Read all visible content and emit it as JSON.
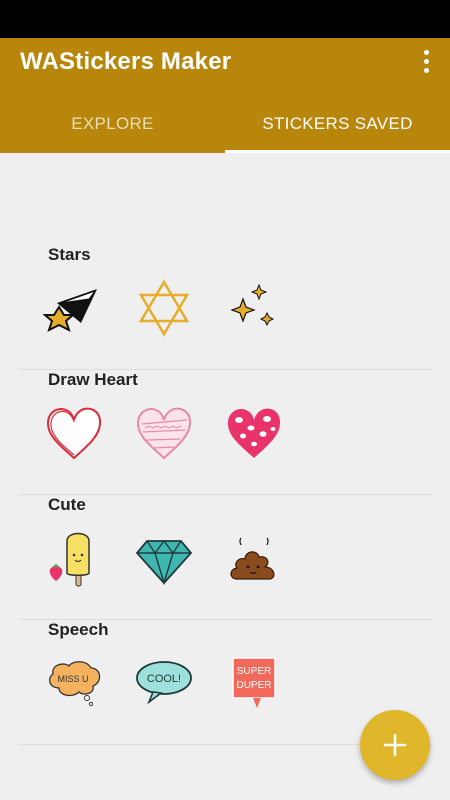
{
  "app": {
    "title": "WAStickers Maker"
  },
  "tabs": [
    {
      "label": "EXPLORE",
      "active": false
    },
    {
      "label": "STICKERS SAVED",
      "active": true
    }
  ],
  "packs": [
    {
      "title": "Stars",
      "stickers": [
        "shooting-star-sticker",
        "hexagram-star-sticker",
        "sparkles-sticker"
      ]
    },
    {
      "title": "Draw Heart",
      "stickers": [
        "red-outline-heart-sticker",
        "pink-pattern-heart-sticker",
        "pink-leopard-heart-sticker"
      ]
    },
    {
      "title": "Cute",
      "stickers": [
        "popsicle-strawberry-sticker",
        "diamond-sticker",
        "poop-sticker"
      ]
    },
    {
      "title": "Speech",
      "stickers": [
        "miss-u-bubble-sticker",
        "cool-bubble-sticker",
        "super-duper-bubble-sticker"
      ]
    }
  ],
  "stickers_text": {
    "miss_u": "MISS U",
    "cool": "COOL!",
    "super": "SUPER",
    "duper": "DUPER"
  },
  "colors": {
    "app_bar": "#b8860b",
    "fab": "#e0b62b",
    "background": "#efefef"
  }
}
